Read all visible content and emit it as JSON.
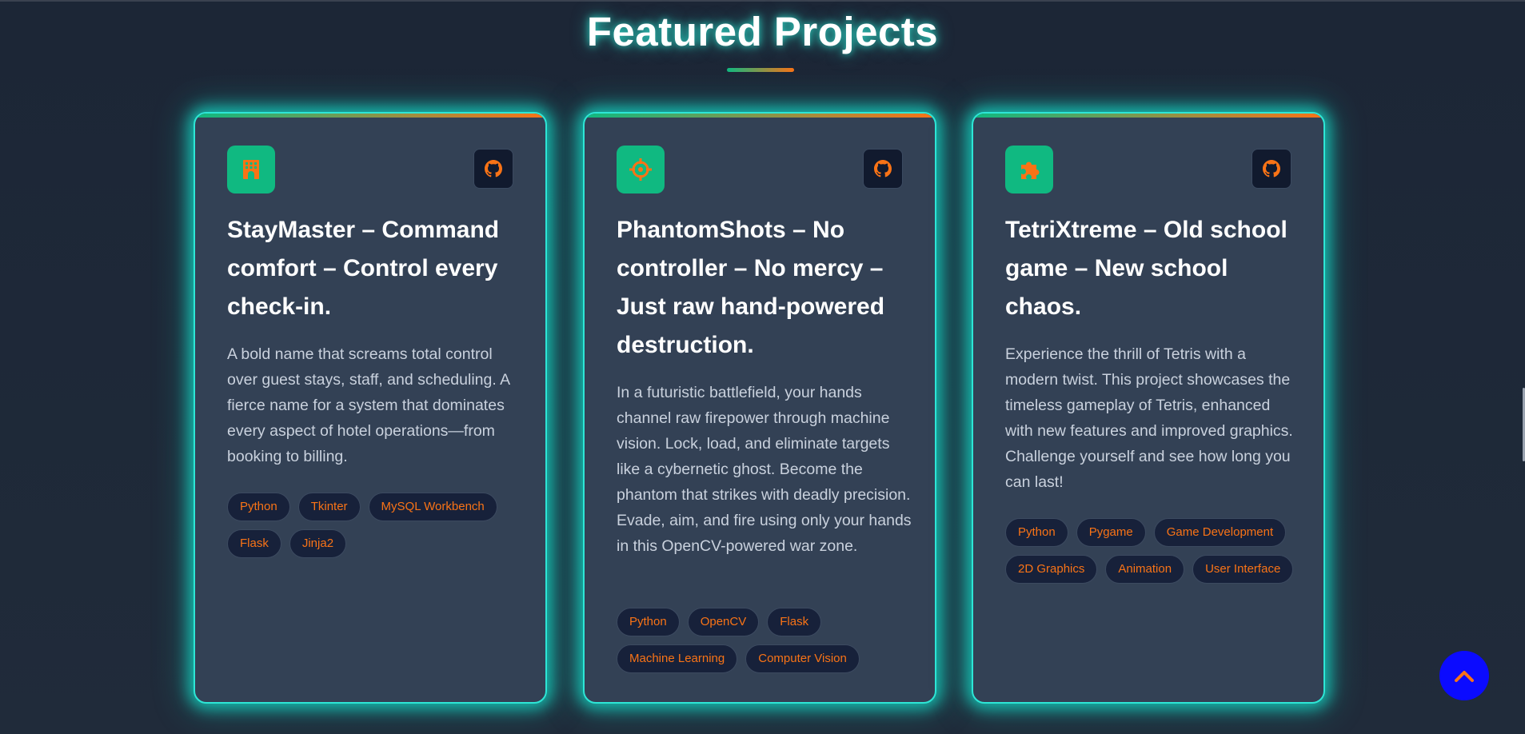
{
  "section": {
    "title": "Featured Projects"
  },
  "projects": [
    {
      "icon": "hotel-icon",
      "title": "StayMaster – Command comfort – Control every check-in.",
      "description": "A bold name that screams total control over guest stays, staff, and scheduling. A fierce name for a system that dominates every aspect of hotel operations—from booking to billing.",
      "tags": [
        "Python",
        "Tkinter",
        "MySQL Workbench",
        "Flask",
        "Jinja2"
      ]
    },
    {
      "icon": "crosshair-icon",
      "title": "PhantomShots – No controller – No mercy – Just raw hand-powered destruction.",
      "description": "In a futuristic battlefield, your hands channel raw firepower through machine vision. Lock, load, and eliminate targets like a cybernetic ghost. Become the phantom that strikes with deadly precision. Evade, aim, and fire using only your hands in this OpenCV-powered war zone.",
      "tags": [
        "Python",
        "OpenCV",
        "Flask",
        "Machine Learning",
        "Computer Vision"
      ]
    },
    {
      "icon": "puzzle-icon",
      "title": "TetriXtreme – Old school game – New school chaos.",
      "description": "Experience the thrill of Tetris with a modern twist. This project showcases the timeless gameplay of Tetris, enhanced with new features and improved graphics. Challenge yourself and see how long you can last!",
      "tags": [
        "Python",
        "Pygame",
        "Game Development",
        "2D Graphics",
        "Animation",
        "User Interface"
      ]
    }
  ],
  "colors": {
    "accent_green": "#10b981",
    "accent_orange": "#f97316",
    "glow_cyan": "#2ee6d6",
    "card_bg": "#334155",
    "page_bg": "#1f2937",
    "scroll_button": "#0b0bff"
  },
  "scroll_top_icon": "chevron-up-icon",
  "github_icon": "github-icon"
}
